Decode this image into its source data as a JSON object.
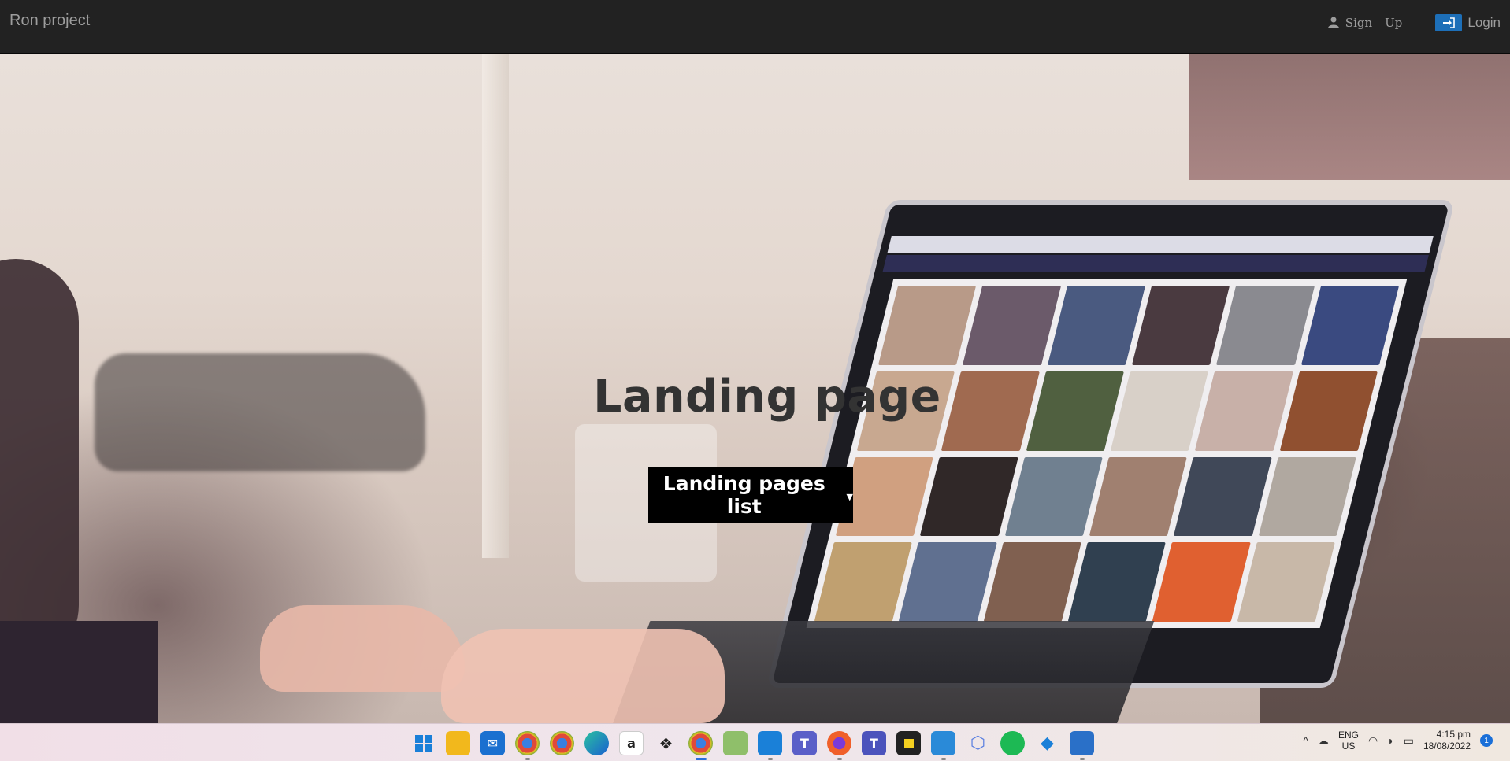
{
  "navbar": {
    "brand": "Ron project",
    "signup_word1": "Sign",
    "signup_word2": "Up",
    "login_label": "Login"
  },
  "hero": {
    "title": "Landing page",
    "dropdown_label": "Landing pages list"
  },
  "taskbar": {
    "apps": [
      "start-icon",
      "file-explorer-icon",
      "mail-icon",
      "chrome-icon",
      "chrome-icon",
      "edge-icon",
      "amazon-icon",
      "dropbox-icon",
      "chrome-icon",
      "photo-editor-icon",
      "vscode-icon",
      "teams-icon",
      "firefox-icon",
      "teams-icon",
      "sticky-notes-icon",
      "notepad-icon",
      "app-icon",
      "spotify-icon",
      "azure-icon",
      "photos-icon"
    ],
    "lang_line1": "ENG",
    "lang_line2": "US",
    "time": "4:15 pm",
    "date": "18/08/2022",
    "notification_count": "1"
  }
}
